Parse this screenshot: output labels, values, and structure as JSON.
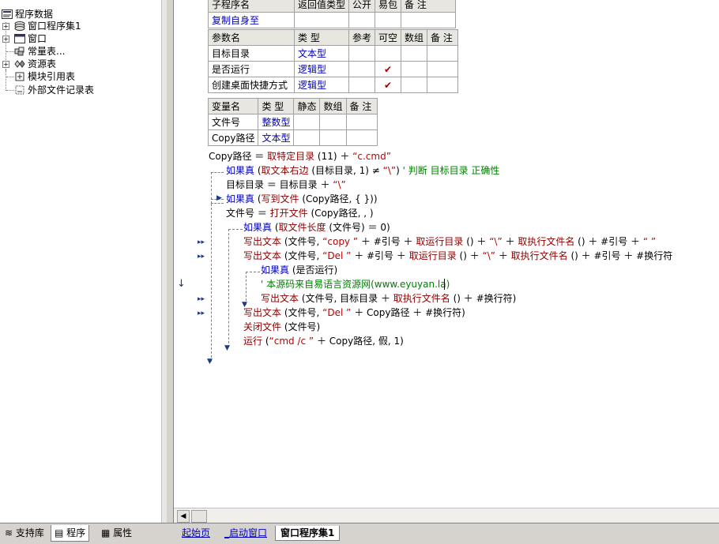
{
  "tree": {
    "root": "程序数据",
    "items": [
      {
        "label": "窗口程序集1",
        "icon": "assembly-icon",
        "expandable": true
      },
      {
        "label": "窗口",
        "icon": "window-icon",
        "expandable": true
      },
      {
        "label": "常量表...",
        "icon": "constants-icon",
        "expandable": false
      },
      {
        "label": "资源表",
        "icon": "resources-icon",
        "expandable": true
      },
      {
        "label": "模块引用表",
        "icon": "module-icon",
        "expandable": false
      },
      {
        "label": "外部文件记录表",
        "icon": "file-record-icon",
        "expandable": false
      }
    ]
  },
  "left_tabs": [
    "支持库",
    "程序",
    "属性"
  ],
  "doc_tabs": [
    "起始页",
    "_启动窗口",
    "窗口程序集1"
  ],
  "sub_table": {
    "headers": [
      "子程序名",
      "返回值类型",
      "公开",
      "易包",
      "备 注"
    ],
    "name": "复制自身至"
  },
  "param_table": {
    "headers": [
      "参数名",
      "类 型",
      "参考",
      "可空",
      "数组",
      "备 注"
    ],
    "rows": [
      {
        "name": "目标目录",
        "type": "文本型",
        "nullable": ""
      },
      {
        "name": "是否运行",
        "type": "逻辑型",
        "nullable": "✔"
      },
      {
        "name": "创建桌面快捷方式",
        "type": "逻辑型",
        "nullable": "✔"
      }
    ]
  },
  "var_table": {
    "headers": [
      "变量名",
      "类 型",
      "静态",
      "数组",
      "备 注"
    ],
    "rows": [
      {
        "name": "文件号",
        "type": "整数型"
      },
      {
        "name": "Copy路径",
        "type": "文本型"
      }
    ]
  },
  "code": {
    "l1": {
      "a": "Copy路径 ＝ ",
      "b": "取特定目录",
      "c": " (11) ＋ ",
      "d": "“c.cmd”"
    },
    "l2": {
      "a": "如果真",
      "b": " (",
      "c": "取文本右边",
      "d": " (目标目录, 1) ≠ ",
      "e": "“\\”",
      "f": ")  ",
      "g": "' 判断 目标目录 正确性"
    },
    "l3": {
      "a": "目标目录 ＝ 目标目录 ＋ ",
      "b": "“\\”"
    },
    "l4": {
      "a": "如果真",
      "b": " (",
      "c": "写到文件",
      "d": " (Copy路径, {  }))"
    },
    "l5": {
      "a": "文件号 ＝ ",
      "b": "打开文件",
      "c": " (Copy路径, , )"
    },
    "l6": {
      "a": "如果真",
      "b": " (",
      "c": "取文件长度",
      "d": " (文件号) ＝ 0)"
    },
    "l7": {
      "a": "写出文本",
      "b": " (文件号, ",
      "c": "“copy ”",
      "d": " ＋ #引号 ＋ ",
      "e": "取运行目录",
      "f": " () ＋ ",
      "g": "“\\”",
      "h": " ＋ ",
      "i": "取执行文件名",
      "j": " () ＋ #引号 ＋ ",
      "k": "“ ”"
    },
    "l8": {
      "a": "写出文本",
      "b": " (文件号, ",
      "c": "“Del ”",
      "d": " ＋ #引号 ＋ ",
      "e": "取运行目录",
      "f": " () ＋ ",
      "g": "“\\”",
      "h": " ＋ ",
      "i": "取执行文件名",
      "j": " () ＋ #引号 ＋ #换行符"
    },
    "l9": {
      "a": "如果真",
      "b": " (是否运行)"
    },
    "l10": {
      "a": "' 本源码来自易语言资源网(www.eyuyan.la)"
    },
    "l11": {
      "a": "写出文本",
      "b": " (文件号, 目标目录 ＋ ",
      "c": "取执行文件名",
      "d": " () ＋ #换行符)"
    },
    "l12": {
      "a": "写出文本",
      "b": " (文件号, ",
      "c": "“Del ”",
      "d": " ＋ Copy路径 ＋ #换行符)"
    },
    "l13": {
      "a": "关闭文件",
      "b": " (文件号)"
    },
    "l14": {
      "a": "运行",
      "b": " (",
      "c": "“cmd /c ”",
      "d": " ＋ Copy路径, 假, 1)"
    }
  },
  "colors": {
    "keyword": "#0000c0",
    "function": "#8b0000",
    "string": "#c00000",
    "comment": "#008000"
  }
}
